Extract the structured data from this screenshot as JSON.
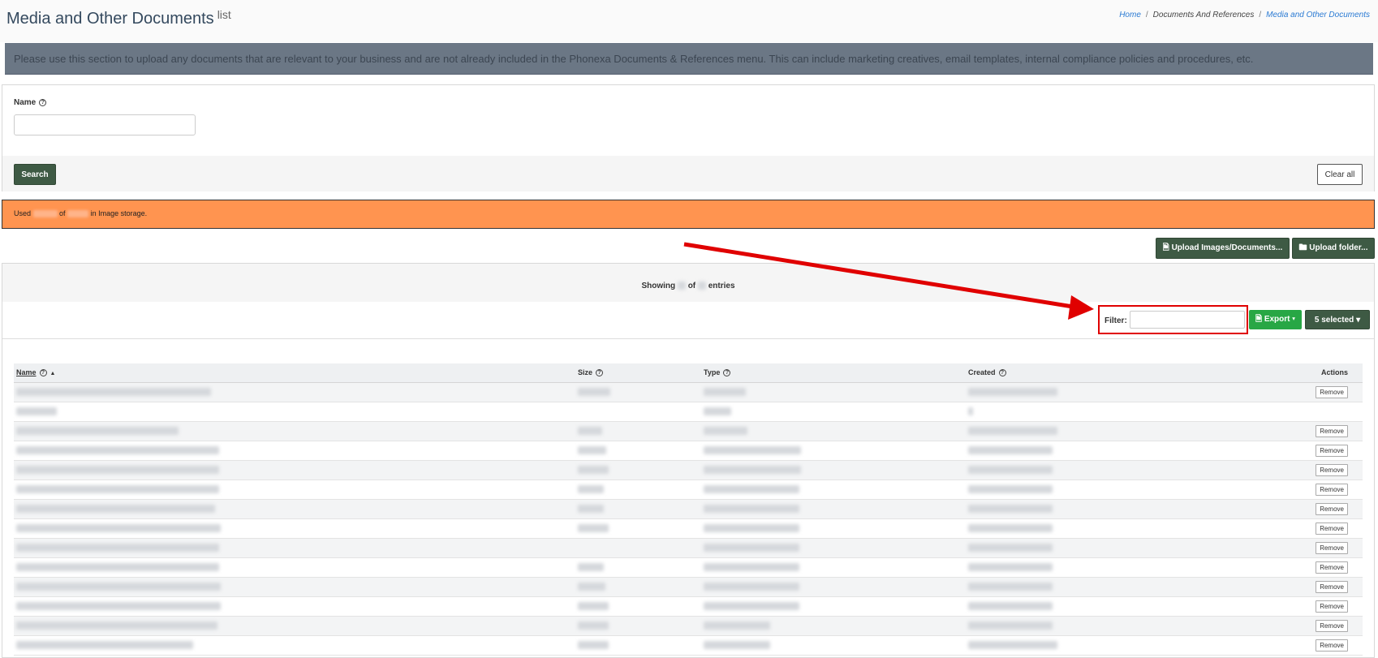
{
  "header": {
    "title": "Media and Other Documents",
    "title_sub": "list",
    "breadcrumb": {
      "home": "Home",
      "middle": "Documents And References",
      "current": "Media and Other Documents"
    }
  },
  "info_banner": "Please use this section to upload any documents that are relevant to your business and are not already included in the Phonexa Documents & References menu. This can include marketing creatives, email templates, internal compliance policies and procedures, etc.",
  "search": {
    "name_label": "Name",
    "name_value": "",
    "search_label": "Search",
    "clear_label": "Clear all"
  },
  "storage": {
    "used_prefix": "Used",
    "of": "of",
    "suffix": "in Image storage."
  },
  "upload": {
    "docs_label": "Upload Images/Documents...",
    "folder_label": "Upload folder..."
  },
  "listing": {
    "showing": "Showing",
    "of": "of",
    "entries": "entries",
    "filter_label": "Filter:",
    "filter_value": "",
    "export_label": "Export",
    "selected_label": "5 selected"
  },
  "table": {
    "columns": {
      "name": "Name",
      "size": "Size",
      "type": "Type",
      "created": "Created",
      "actions": "Actions"
    },
    "remove_label": "Remove",
    "rows": [
      {
        "remove": true
      },
      {
        "remove": false
      },
      {
        "remove": true
      },
      {
        "remove": true
      },
      {
        "remove": true
      },
      {
        "remove": true
      },
      {
        "remove": true
      },
      {
        "remove": true
      },
      {
        "remove": true
      },
      {
        "remove": true
      },
      {
        "remove": true
      },
      {
        "remove": true
      },
      {
        "remove": true
      },
      {
        "remove": true
      }
    ]
  },
  "colors": {
    "primary_button": "#3e5a44",
    "export_button": "#28a745",
    "storage_banner": "#ff9450",
    "highlight": "#e00000"
  }
}
